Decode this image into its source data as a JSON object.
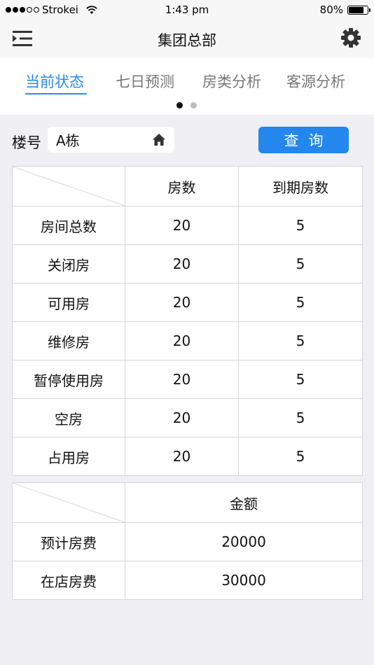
{
  "status_bar": {
    "carrier": "Strokei",
    "time": "1:43 pm",
    "battery": "80%",
    "battery_level": 0.8
  },
  "nav": {
    "title": "集团总部"
  },
  "tabs": [
    {
      "label": "当前状态",
      "active": true
    },
    {
      "label": "七日预测",
      "active": false
    },
    {
      "label": "房类分析",
      "active": false
    },
    {
      "label": "客源分析",
      "active": false
    }
  ],
  "pager": {
    "count": 2,
    "active_index": 0
  },
  "query": {
    "building_label": "楼号",
    "building_value": "A栋",
    "button_label": "查询"
  },
  "room_table": {
    "headers": [
      "",
      "房数",
      "到期房数"
    ],
    "rows": [
      {
        "label": "房间总数",
        "rooms": "20",
        "due": "5"
      },
      {
        "label": "关闭房",
        "rooms": "20",
        "due": "5"
      },
      {
        "label": "可用房",
        "rooms": "20",
        "due": "5"
      },
      {
        "label": "维修房",
        "rooms": "20",
        "due": "5"
      },
      {
        "label": "暂停使用房",
        "rooms": "20",
        "due": "5"
      },
      {
        "label": "空房",
        "rooms": "20",
        "due": "5"
      },
      {
        "label": "占用房",
        "rooms": "20",
        "due": "5"
      }
    ]
  },
  "fee_table": {
    "headers": [
      "",
      "金额"
    ],
    "rows": [
      {
        "label": "预计房费",
        "amount": "20000"
      },
      {
        "label": "在店房费",
        "amount": "30000"
      }
    ]
  },
  "colors": {
    "accent": "#2a8ae8",
    "button": "#2387ee",
    "background": "#efeff4"
  },
  "icons": [
    "signal-dots-icon",
    "wifi-icon",
    "battery-icon",
    "menu-sliders-icon",
    "gear-icon",
    "home-icon"
  ]
}
